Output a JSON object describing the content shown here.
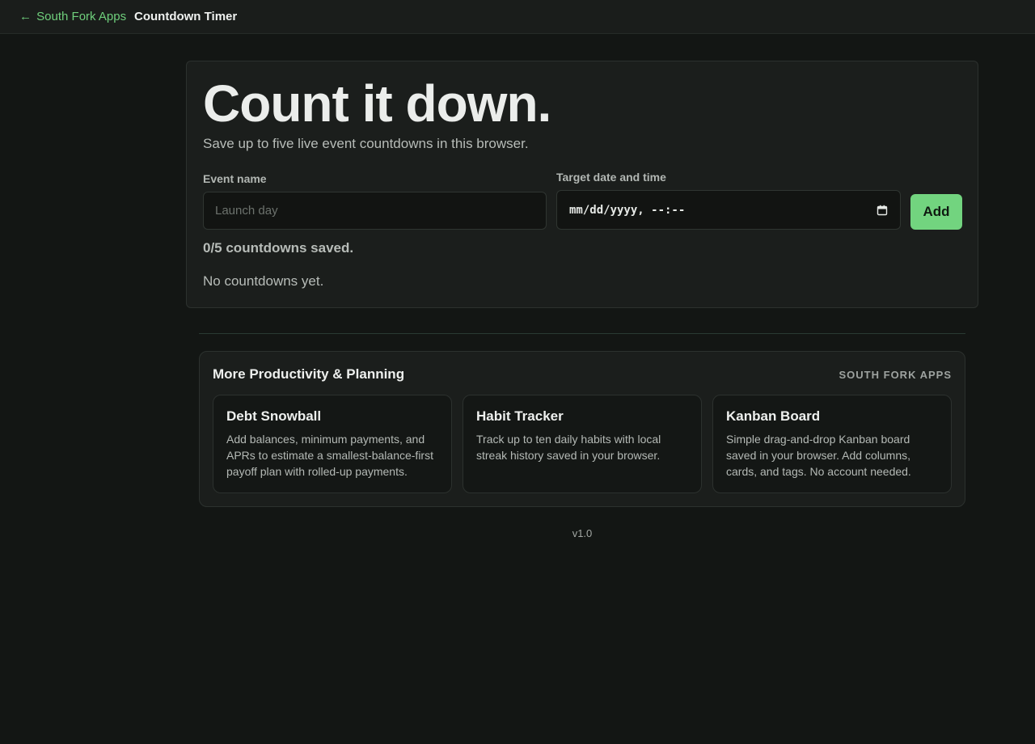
{
  "nav": {
    "back_arrow": "←",
    "back_label": "South Fork Apps",
    "page_title": "Countdown Timer"
  },
  "hero": {
    "title": "Count it down.",
    "subtitle": "Save up to five live event countdowns in this browser."
  },
  "form": {
    "event_name_label": "Event name",
    "event_name_placeholder": "Launch day",
    "event_name_value": "",
    "target_label": "Target date and time",
    "target_placeholder": "mm/dd/yyyy, --:--",
    "add_label": "Add"
  },
  "status": {
    "saved_count": "0/5 countdowns saved.",
    "empty_message": "No countdowns yet."
  },
  "more": {
    "title": "More Productivity & Planning",
    "brand": "SOUTH FORK APPS",
    "apps": [
      {
        "name": "Debt Snowball",
        "description": "Add balances, minimum payments, and APRs to estimate a smallest-balance-first payoff plan with rolled-up payments."
      },
      {
        "name": "Habit Tracker",
        "description": "Track up to ten daily habits with local streak history saved in your browser."
      },
      {
        "name": "Kanban Board",
        "description": "Simple drag-and-drop Kanban board saved in your browser. Add columns, cards, and tags. No account needed."
      }
    ]
  },
  "footer": {
    "version": "v1.0"
  },
  "colors": {
    "background": "#131614",
    "card": "#1b1e1c",
    "accent": "#72d47f",
    "link": "#6fcf7c"
  },
  "icons": {
    "back": "arrow-left-icon",
    "date_picker": "calendar-icon"
  }
}
